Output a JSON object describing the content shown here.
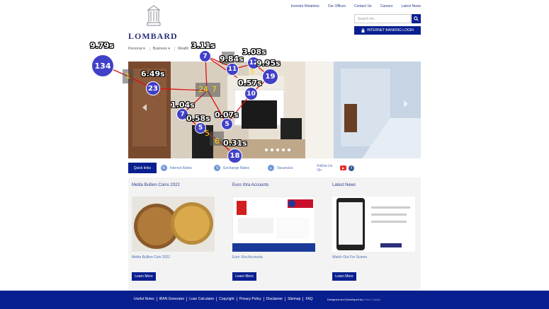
{
  "header": {
    "logo_text": "LOMBARD",
    "top_links": [
      "Investor Relations",
      "Our Offices",
      "Contact Us",
      "Careers",
      "Latest News"
    ],
    "search_placeholder": "Search for...",
    "login_label": "INTERNET BANKING LOGIN"
  },
  "nav": [
    "Personal ▾",
    "Business ▾",
    "Wealth"
  ],
  "quick": {
    "label": "Quick links",
    "items": [
      "Interest Rates",
      "Exchange Rates",
      "Vacancies"
    ],
    "follow": "Follow Us On"
  },
  "cards": [
    {
      "title": "Melita Bullion Coins 2022",
      "caption": "Melita Bullion Coin 2022",
      "button": "Learn More"
    },
    {
      "title": "Euro Xtra Accounts",
      "caption": "Euro Xtra Accounts",
      "button": "Learn More"
    },
    {
      "title": "Latest News",
      "caption": "Watch Out For Scams",
      "button": "Learn More"
    }
  ],
  "footer": {
    "links": [
      "Useful Notes",
      "IBAN Generator",
      "Loan Calculator",
      "Copyright",
      "Privacy Policy",
      "Disclaimer",
      "Sitemap",
      "FAQ"
    ],
    "credit_prefix": "Designed and Developed by",
    "credit_name": "Deltco Digital"
  },
  "overlay": {
    "times": [
      "9.79s",
      "6.49s",
      "3.11s",
      "9.84s",
      "3.08s",
      "9.95s",
      "0.57s",
      "1.04s",
      "0.58s",
      "0.07s",
      "0.31s"
    ],
    "circles": [
      "134",
      "23",
      "7",
      "12",
      "11",
      "19",
      "10",
      "7",
      "5",
      "5",
      "18"
    ],
    "yellow": [
      "1",
      "24",
      "7",
      "3",
      "6",
      "5"
    ]
  },
  "colors": {
    "brand": "#0a1f8f",
    "accent": "#4141c8",
    "path": "#e01010"
  }
}
